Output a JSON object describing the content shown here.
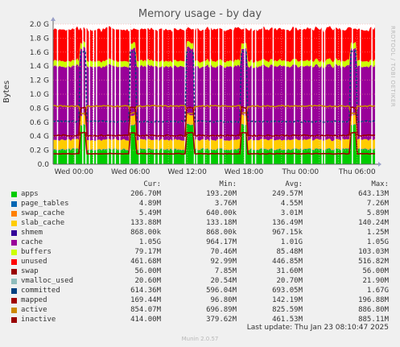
{
  "chart_data": {
    "type": "area",
    "title": "Memory usage - by day",
    "ylabel": "Bytes",
    "side_credit": "RRDTOOL / TOBI OETIKER",
    "ylim": [
      0,
      2.0
    ],
    "y_ticks": [
      "0.0",
      "0.2 G",
      "0.4 G",
      "0.6 G",
      "0.8 G",
      "1.0 G",
      "1.2 G",
      "1.4 G",
      "1.6 G",
      "1.8 G",
      "2.0 G"
    ],
    "x_ticks": [
      "Wed 00:00",
      "Wed 06:00",
      "Wed 12:00",
      "Wed 18:00",
      "Thu 00:00",
      "Thu 06:00"
    ],
    "x_range_hours": [
      -2.2,
      31.9
    ],
    "grid": true,
    "series_colors": {
      "apps": "#00cc00",
      "page_tables": "#0066b3",
      "swap_cache": "#ff8000",
      "slab_cache": "#ffcc00",
      "shmem": "#330099",
      "cache": "#990099",
      "buffers": "#ccff00",
      "unused": "#ff0000",
      "committed": "#004080",
      "mapped": "#a00000",
      "active": "#cc8800",
      "inactive": "#990000"
    },
    "stack_approx": {
      "apps": 0.21,
      "page_tables": 0.005,
      "swap_cache": 0.005,
      "slab_cache": 0.13,
      "shmem": 0.001,
      "cache": 1.05,
      "buffers": 0.08,
      "unused": 0.45
    },
    "lines_approx": {
      "committed": 0.61,
      "mapped": 0.15,
      "active": 0.83,
      "inactive": 0.41
    },
    "spike_hours": [
      1.0,
      6.3,
      12.3,
      18.0,
      29.6
    ]
  },
  "legend": {
    "columns": [
      "Cur:",
      "Min:",
      "Avg:",
      "Max:"
    ],
    "rows": [
      {
        "name": "apps",
        "color": "#00cc00",
        "cur": "206.70M",
        "min": "193.20M",
        "avg": "249.57M",
        "max": "643.13M"
      },
      {
        "name": "page_tables",
        "color": "#0066b3",
        "cur": "4.89M",
        "min": "3.76M",
        "avg": "4.55M",
        "max": "7.26M"
      },
      {
        "name": "swap_cache",
        "color": "#ff8000",
        "cur": "5.49M",
        "min": "640.00k",
        "avg": "3.01M",
        "max": "5.89M"
      },
      {
        "name": "slab_cache",
        "color": "#ffcc00",
        "cur": "133.88M",
        "min": "133.18M",
        "avg": "136.49M",
        "max": "140.24M"
      },
      {
        "name": "shmem",
        "color": "#330099",
        "cur": "868.00k",
        "min": "868.00k",
        "avg": "967.15k",
        "max": "1.25M"
      },
      {
        "name": "cache",
        "color": "#990099",
        "cur": "1.05G",
        "min": "964.17M",
        "avg": "1.01G",
        "max": "1.05G"
      },
      {
        "name": "buffers",
        "color": "#ccff00",
        "cur": "79.17M",
        "min": "70.46M",
        "avg": "85.48M",
        "max": "103.03M"
      },
      {
        "name": "unused",
        "color": "#ff0000",
        "cur": "461.68M",
        "min": "92.99M",
        "avg": "446.85M",
        "max": "516.82M"
      },
      {
        "name": "swap",
        "color": "#990000",
        "cur": "56.00M",
        "min": "7.85M",
        "avg": "31.60M",
        "max": "56.00M"
      },
      {
        "name": "vmalloc_used",
        "color": "#8fbcbc",
        "cur": "20.60M",
        "min": "20.54M",
        "avg": "20.70M",
        "max": "21.90M"
      },
      {
        "name": "committed",
        "color": "#004080",
        "cur": "614.36M",
        "min": "596.04M",
        "avg": "693.05M",
        "max": "1.67G"
      },
      {
        "name": "mapped",
        "color": "#a00000",
        "cur": "169.44M",
        "min": "96.80M",
        "avg": "142.19M",
        "max": "196.88M"
      },
      {
        "name": "active",
        "color": "#cc8800",
        "cur": "854.07M",
        "min": "696.89M",
        "avg": "825.59M",
        "max": "886.80M"
      },
      {
        "name": "inactive",
        "color": "#990000",
        "cur": "414.00M",
        "min": "379.62M",
        "avg": "461.53M",
        "max": "885.11M"
      }
    ]
  },
  "footer": {
    "last_update": "Last update: Thu Jan 23 08:10:47 2025",
    "version": "Munin 2.0.57"
  }
}
